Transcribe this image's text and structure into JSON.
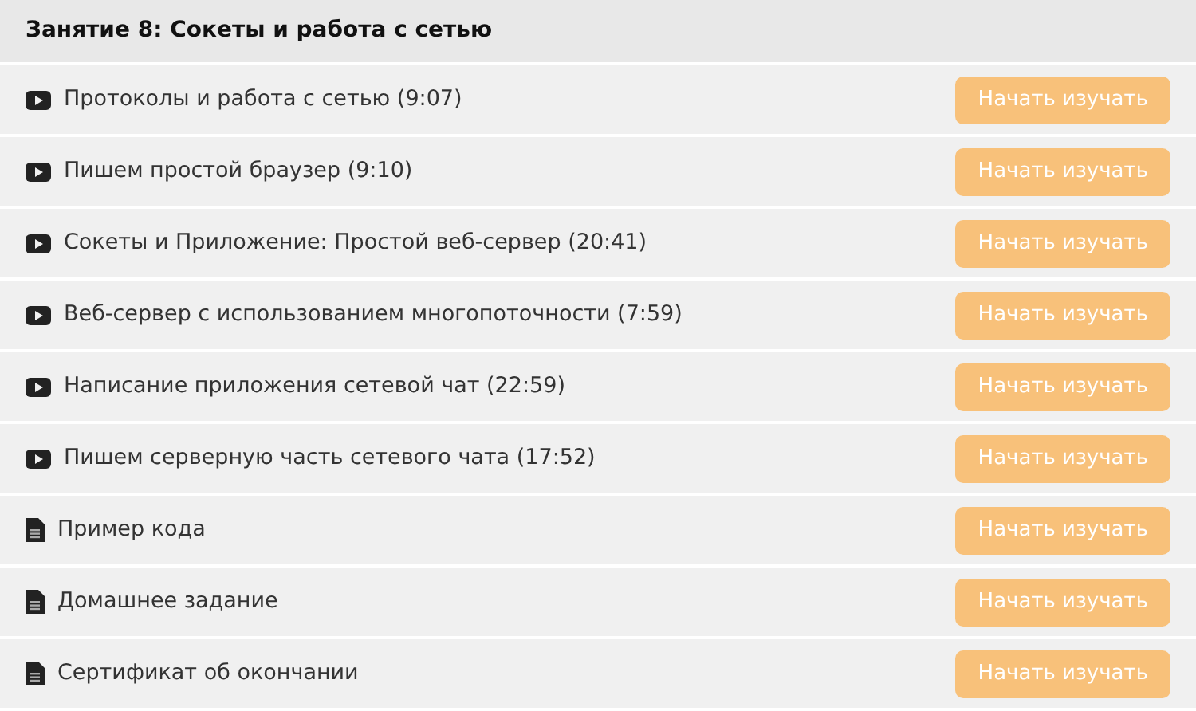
{
  "section": {
    "title": "Занятие 8: Сокеты и работа с сетью"
  },
  "lessons": [
    {
      "kind": "video",
      "title": "Протоколы и работа с сетью (9:07)",
      "button": "Начать изучать"
    },
    {
      "kind": "video",
      "title": "Пишем простой браузер (9:10)",
      "button": "Начать изучать"
    },
    {
      "kind": "video",
      "title": "Сокеты и Приложение: Простой веб-сервер (20:41)",
      "button": "Начать изучать"
    },
    {
      "kind": "video",
      "title": "Веб-сервер с использованием многопоточности (7:59)",
      "button": "Начать изучать"
    },
    {
      "kind": "video",
      "title": "Написание приложения сетевой чат (22:59)",
      "button": "Начать изучать"
    },
    {
      "kind": "video",
      "title": "Пишем серверную часть сетевого чата (17:52)",
      "button": "Начать изучать"
    },
    {
      "kind": "document",
      "title": "Пример кода",
      "button": "Начать изучать"
    },
    {
      "kind": "document",
      "title": "Домашнее задание",
      "button": "Начать изучать"
    },
    {
      "kind": "document",
      "title": "Сертификат об окончании",
      "button": "Начать изучать"
    }
  ]
}
